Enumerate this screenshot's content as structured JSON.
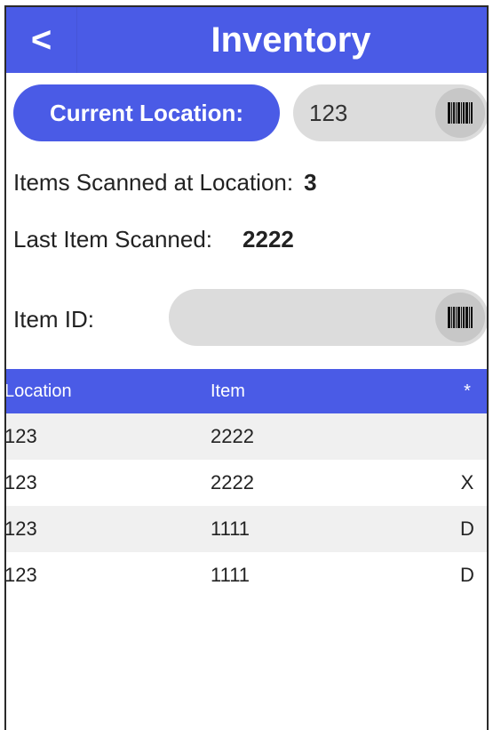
{
  "header": {
    "back_label": "<",
    "title": "Inventory"
  },
  "location": {
    "button_label": "Current Location:",
    "value": "123",
    "barcode_icon": "barcode-icon"
  },
  "stats": {
    "items_scanned_label": "Items Scanned at Location:",
    "items_scanned_value": "3",
    "last_item_label": "Last Item Scanned:",
    "last_item_value": "2222"
  },
  "item": {
    "label": "Item ID:",
    "value": "",
    "placeholder": ""
  },
  "table": {
    "columns": [
      "Location",
      "Item",
      "*"
    ],
    "rows": [
      {
        "location": "123",
        "item": "2222",
        "flag": ""
      },
      {
        "location": "123",
        "item": "2222",
        "flag": "X"
      },
      {
        "location": "123",
        "item": "1111",
        "flag": "D"
      },
      {
        "location": "123",
        "item": "1111",
        "flag": "D"
      }
    ]
  },
  "colors": {
    "accent": "#4a5be6",
    "field_bg": "#dcdcdc",
    "row_alt": "#f0f0f0"
  }
}
